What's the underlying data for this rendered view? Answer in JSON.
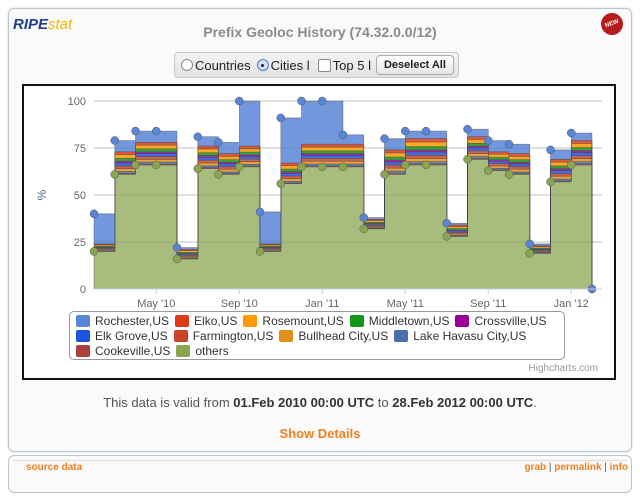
{
  "logo": {
    "ripe": "RIPE",
    "stat": "stat"
  },
  "title": "Prefix Geoloc History (74.32.0.0/12)",
  "new_badge": "NEW",
  "controls": {
    "countries": "Countries",
    "cities": "Cities l",
    "top5": "Top 5 l",
    "deselect": "Deselect All",
    "selected": "cities",
    "top5_checked": false
  },
  "chart_data": {
    "type": "area",
    "stacking": "normal",
    "step": true,
    "ylabel": "%",
    "ylim": [
      0,
      100
    ],
    "yticks": [
      0,
      25,
      50,
      75,
      100
    ],
    "grid": true,
    "x_start": "2010-02-01",
    "x_interval": "1 month",
    "x": [
      "Feb 2010",
      "Mar 2010",
      "Apr 2010",
      "May 2010",
      "Jun 2010",
      "Jul 2010",
      "Aug 2010",
      "Sep 2010",
      "Oct 2010",
      "Nov 2010",
      "Dec 2010",
      "Jan 2011",
      "Feb 2011",
      "Mar 2011",
      "Apr 2011",
      "May 2011",
      "Jun 2011",
      "Jul 2011",
      "Aug 2011",
      "Sep 2011",
      "Oct 2011",
      "Nov 2011",
      "Dec 2011",
      "Jan 2012",
      "Feb 2012"
    ],
    "xtick_labels": [
      "May '10",
      "Sep '10",
      "Jan '11",
      "May '11",
      "Sep '11",
      "Jan '12"
    ],
    "legend_position": "bottom",
    "credit": "Highcharts.com",
    "series": [
      {
        "name": "Rochester,US",
        "color": "#5b85d6",
        "values": [
          16,
          6,
          6,
          6,
          1,
          5,
          6,
          24,
          17,
          24,
          23,
          23,
          5,
          1,
          6,
          4,
          4,
          1,
          4,
          6,
          5,
          1,
          5,
          4,
          0
        ]
      },
      {
        "name": "Elko,US",
        "color": "#dd3a1a",
        "values": [
          0.5,
          1.5,
          1.5,
          1.5,
          0.6,
          1.5,
          1.4,
          1.4,
          0.5,
          1.4,
          1.5,
          1.5,
          1.5,
          0.6,
          1.6,
          1.8,
          1.8,
          0.8,
          1.5,
          1.3,
          1.4,
          0.5,
          1.5,
          1.6,
          0
        ]
      },
      {
        "name": "Rosemount,US",
        "color": "#ff9900",
        "values": [
          0.7,
          2,
          2,
          2,
          0.9,
          2,
          1.8,
          1.8,
          0.7,
          1.8,
          2,
          2,
          2,
          0.9,
          2.2,
          2.4,
          2.4,
          1,
          2,
          1.6,
          1.8,
          0.7,
          2,
          2.2,
          0
        ]
      },
      {
        "name": "Middletown,US",
        "color": "#109618",
        "values": [
          0.5,
          1.5,
          1.5,
          1.5,
          0.6,
          1.5,
          1.4,
          1.4,
          0.5,
          1.4,
          1.5,
          1.5,
          1.5,
          0.6,
          1.6,
          1.8,
          1.8,
          0.8,
          1.5,
          1.3,
          1.4,
          0.5,
          1.5,
          1.6,
          0
        ]
      },
      {
        "name": "Crossville,US",
        "color": "#990099",
        "values": [
          0.3,
          1,
          1,
          1,
          0.4,
          1,
          0.9,
          0.9,
          0.3,
          0.9,
          1,
          1,
          1,
          0.4,
          1.1,
          1.2,
          1.2,
          0.5,
          1,
          0.8,
          0.9,
          0.3,
          1,
          1.1,
          0
        ]
      },
      {
        "name": "Elk Grove,US",
        "color": "#1a56e0",
        "values": [
          0.5,
          1.5,
          1.5,
          1.5,
          0.6,
          1.5,
          1.4,
          1.4,
          0.5,
          1.4,
          1.5,
          1.5,
          1.5,
          0.6,
          1.6,
          1.7,
          1.7,
          0.8,
          1.5,
          1.3,
          1.4,
          0.5,
          1.5,
          1.6,
          0
        ]
      },
      {
        "name": "Farmington,US",
        "color": "#c8452a",
        "values": [
          0.5,
          1.5,
          1.5,
          1.5,
          0.6,
          1.5,
          1.4,
          1.4,
          0.5,
          1.4,
          1.5,
          1.5,
          1.5,
          0.6,
          1.6,
          1.7,
          1.7,
          0.8,
          1.5,
          1.3,
          1.4,
          0.5,
          1.5,
          1.6,
          0
        ]
      },
      {
        "name": "Bullhead City,US",
        "color": "#e0901a",
        "values": [
          0.5,
          1.5,
          1.5,
          1.5,
          0.6,
          1.5,
          1.4,
          1.4,
          0.5,
          1.4,
          1.5,
          1.5,
          1.5,
          0.6,
          1.6,
          1.7,
          1.7,
          0.7,
          1.5,
          1.2,
          1.4,
          0.5,
          1.5,
          1.6,
          0
        ]
      },
      {
        "name": "Lake Havasu City,US",
        "color": "#4a72a8",
        "values": [
          0.3,
          1,
          1,
          1,
          0.4,
          1,
          0.9,
          0.9,
          0.3,
          0.9,
          1,
          1,
          1,
          0.4,
          1.1,
          1.1,
          1.1,
          0.4,
          1,
          0.8,
          0.9,
          0.3,
          1,
          1.1,
          0
        ]
      },
      {
        "name": "Cookeville,US",
        "color": "#a84040",
        "values": [
          0.2,
          0.5,
          0.5,
          0.5,
          0.3,
          0.5,
          0.4,
          0.4,
          0.2,
          0.4,
          0.5,
          0.5,
          0.5,
          0.3,
          0.6,
          0.6,
          0.6,
          0.2,
          0.5,
          0.4,
          0.4,
          0.2,
          0.5,
          0.6,
          0
        ]
      },
      {
        "name": "others",
        "color": "#8aa552",
        "values": [
          20,
          61,
          66,
          66,
          16,
          64,
          61,
          65,
          20,
          56,
          65,
          65,
          65,
          32,
          61,
          66,
          66,
          28,
          69,
          63,
          61,
          19,
          57,
          66,
          0
        ]
      }
    ]
  },
  "validity": {
    "prefix": "This data is valid from ",
    "from": "01.Feb 2010 00:00 UTC",
    "mid": " to ",
    "to": "28.Feb 2012 00:00 UTC",
    "suffix": "."
  },
  "show_details": "Show Details",
  "footer": {
    "source": "source data",
    "grab": "grab",
    "permalink": "permalink",
    "info": "info",
    "sep": " | "
  }
}
